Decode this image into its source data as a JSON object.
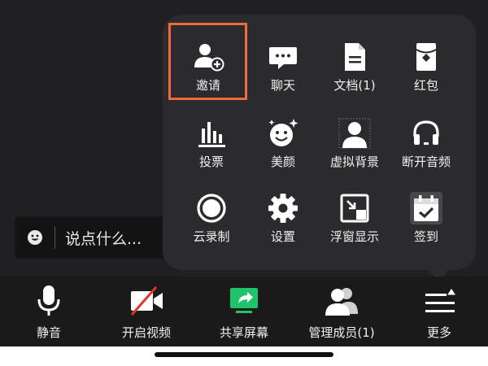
{
  "chat": {
    "placeholder": "说点什么..."
  },
  "menu": {
    "items": [
      {
        "label": "邀请",
        "icon": "add-user-icon"
      },
      {
        "label": "聊天",
        "icon": "chat-bubble-icon"
      },
      {
        "label": "文档(1)",
        "icon": "document-icon"
      },
      {
        "label": "红包",
        "icon": "red-envelope-icon"
      },
      {
        "label": "投票",
        "icon": "vote-bars-icon"
      },
      {
        "label": "美颜",
        "icon": "beauty-face-icon"
      },
      {
        "label": "虚拟背景",
        "icon": "virtual-background-icon"
      },
      {
        "label": "断开音频",
        "icon": "headphones-icon"
      },
      {
        "label": "云录制",
        "icon": "record-icon"
      },
      {
        "label": "设置",
        "icon": "gear-icon"
      },
      {
        "label": "浮窗显示",
        "icon": "floating-window-icon"
      },
      {
        "label": "签到",
        "icon": "calendar-check-icon"
      }
    ]
  },
  "toolbar": {
    "mute_label": "静音",
    "video_label": "开启视频",
    "share_label": "共享屏幕",
    "members_label": "管理成员(1)",
    "more_label": "更多"
  },
  "colors": {
    "highlight": "#f06a3c",
    "share_green": "#1fc46a",
    "video_off_red": "#e0352b"
  }
}
